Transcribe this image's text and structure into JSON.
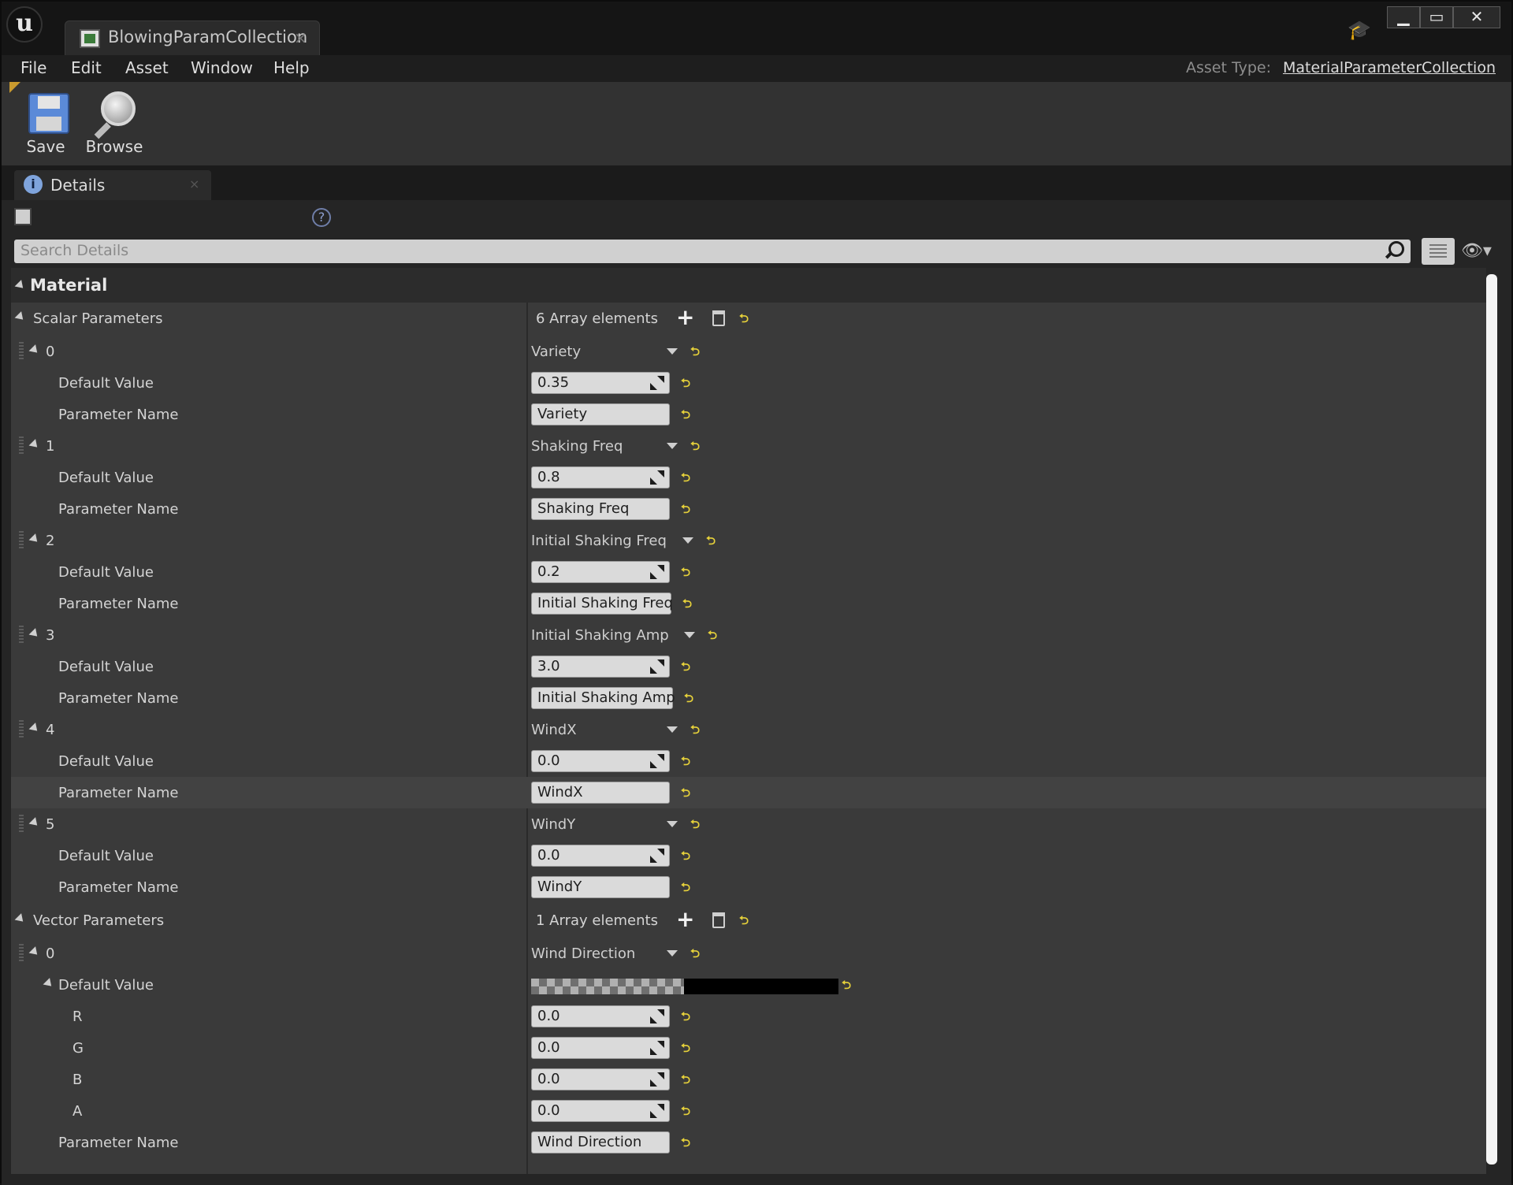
{
  "window": {
    "tab_title": "BlowingParamCollection",
    "tab_close": "×",
    "logo": "u",
    "buttons": {
      "minimize": "▁",
      "maximize": "▭",
      "close": "✕"
    }
  },
  "menu": {
    "items": [
      "File",
      "Edit",
      "Asset",
      "Window",
      "Help"
    ],
    "asset_type_label": "Asset Type:",
    "asset_type_value": "MaterialParameterCollection"
  },
  "toolbar": {
    "save_label": "Save",
    "browse_label": "Browse"
  },
  "details": {
    "tab_label": "Details",
    "tab_close": "×",
    "help": "?",
    "search_placeholder": "Search Details",
    "category": "Material",
    "reset_glyph": "⮌",
    "scalar": {
      "label": "Scalar Parameters",
      "count_text": "6 Array elements",
      "default_value_label": "Default Value",
      "parameter_name_label": "Parameter Name",
      "items": [
        {
          "index": "0",
          "header": "Variety",
          "default_value": "0.35",
          "name": "Variety"
        },
        {
          "index": "1",
          "header": "Shaking Freq",
          "default_value": "0.8",
          "name": "Shaking Freq"
        },
        {
          "index": "2",
          "header": "Initial Shaking Freq",
          "default_value": "0.2",
          "name": "Initial Shaking Freq"
        },
        {
          "index": "3",
          "header": "Initial Shaking Amp",
          "default_value": "3.0",
          "name": "Initial Shaking Amp"
        },
        {
          "index": "4",
          "header": "WindX",
          "default_value": "0.0",
          "name": "WindX"
        },
        {
          "index": "5",
          "header": "WindY",
          "default_value": "0.0",
          "name": "WindY"
        }
      ]
    },
    "vector": {
      "label": "Vector Parameters",
      "count_text": "1 Array elements",
      "item": {
        "index": "0",
        "header": "Wind Direction",
        "default_value_label": "Default Value",
        "color": "#000000",
        "channels": [
          {
            "label": "R",
            "value": "0.0"
          },
          {
            "label": "G",
            "value": "0.0"
          },
          {
            "label": "B",
            "value": "0.0"
          },
          {
            "label": "A",
            "value": "0.0"
          }
        ],
        "parameter_name_label": "Parameter Name",
        "name": "Wind Direction"
      }
    }
  }
}
